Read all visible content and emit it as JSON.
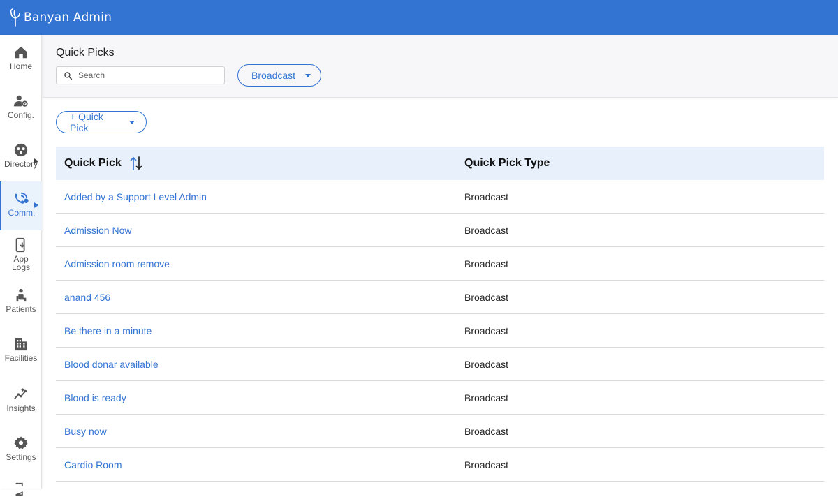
{
  "app": {
    "title": "Banyan Admin"
  },
  "colors": {
    "brand": "#3374d3",
    "header_bg": "#f7f7fa",
    "table_header_bg": "#e8f1fb",
    "link": "#3374d3"
  },
  "sidebar": {
    "items": [
      {
        "label": "Home",
        "icon": "home-icon"
      },
      {
        "label": "Config.",
        "icon": "user-gear-icon"
      },
      {
        "label": "Directory",
        "icon": "directory-icon",
        "has_submenu": true
      },
      {
        "label": "Comm.",
        "icon": "communication-icon",
        "has_submenu": true,
        "active": true
      },
      {
        "label": "App Logs",
        "icon": "app-logs-icon"
      },
      {
        "label": "Patients",
        "icon": "patient-icon"
      },
      {
        "label": "Facilities",
        "icon": "building-icon"
      },
      {
        "label": "Insights",
        "icon": "insights-icon"
      },
      {
        "label": "Settings",
        "icon": "gear-icon"
      }
    ]
  },
  "header": {
    "title": "Quick Picks",
    "search_placeholder": "Search",
    "filter_label": "Broadcast"
  },
  "actions": {
    "add_label": "+ Quick Pick"
  },
  "table": {
    "columns": [
      "Quick Pick",
      "Quick Pick Type"
    ],
    "rows": [
      {
        "name": "Added by a Support Level Admin",
        "type": "Broadcast"
      },
      {
        "name": "Admission Now",
        "type": "Broadcast"
      },
      {
        "name": "Admission room remove",
        "type": "Broadcast"
      },
      {
        "name": "anand 456",
        "type": "Broadcast"
      },
      {
        "name": "Be there in a minute",
        "type": "Broadcast"
      },
      {
        "name": "Blood donar available",
        "type": "Broadcast"
      },
      {
        "name": "Blood is ready",
        "type": "Broadcast"
      },
      {
        "name": "Busy now",
        "type": "Broadcast"
      },
      {
        "name": "Cardio Room",
        "type": "Broadcast"
      }
    ]
  }
}
